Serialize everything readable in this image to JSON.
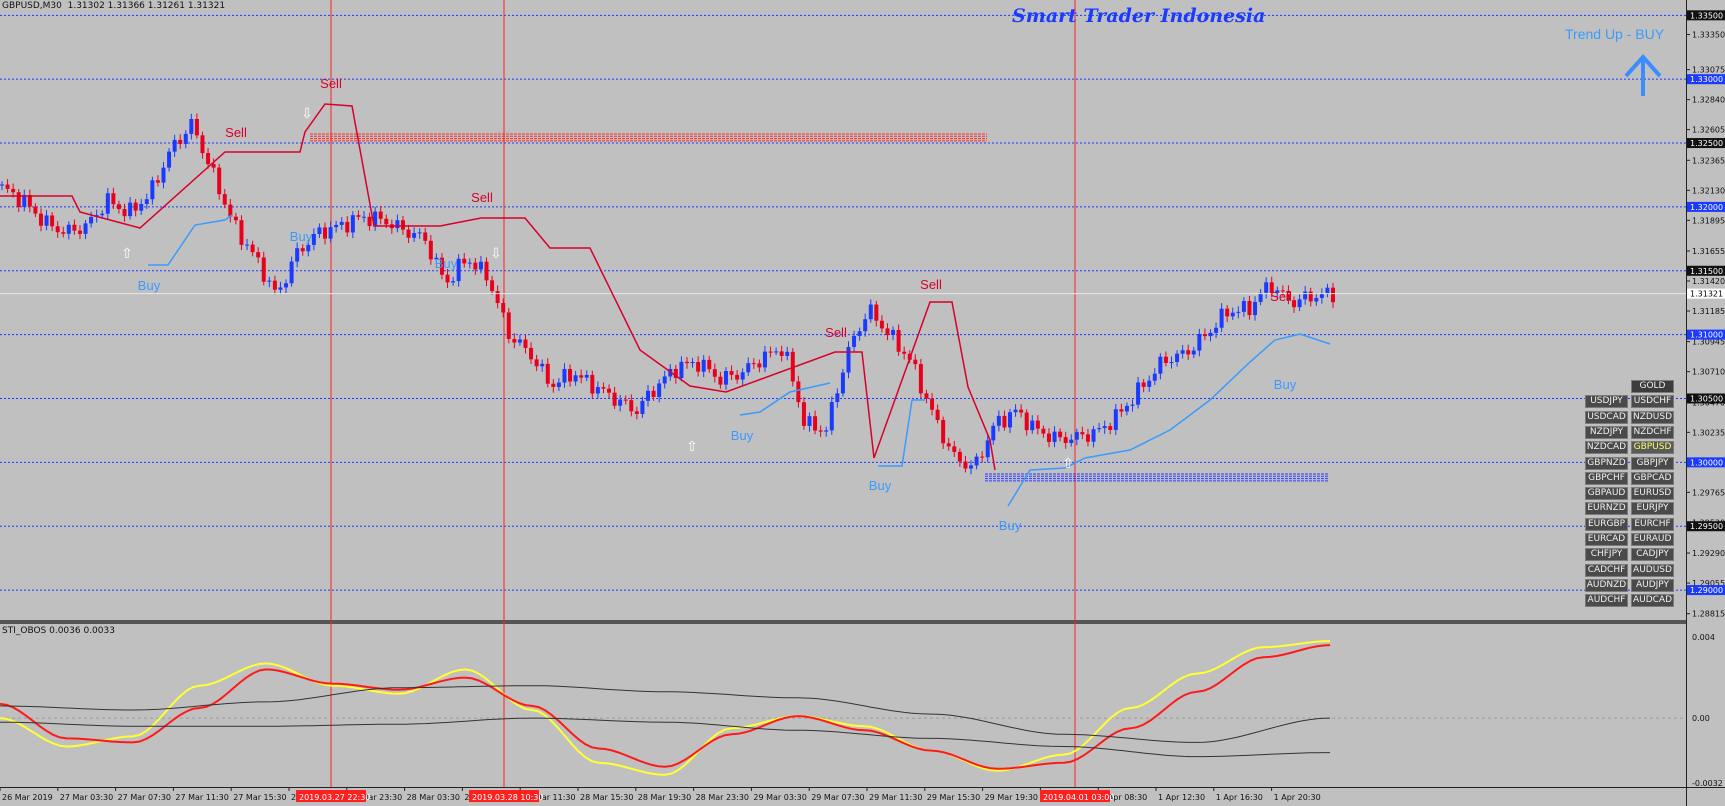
{
  "header": {
    "symbol_info": "GBPUSD,M30  1.31302 1.31366 1.31261 1.31321",
    "brand": "Smart Trader Indonesia",
    "trend_label": "Trend Up - BUY"
  },
  "chart_data": [
    {
      "type": "candlestick",
      "title": "GBPUSD,M30",
      "ohlc_current": {
        "open": 1.31302,
        "high": 1.31366,
        "low": 1.31261,
        "close": 1.31321
      },
      "ylim": [
        1.2875,
        1.3362
      ],
      "y_ticks": [
        "1.33350",
        "1.33075",
        "1.32840",
        "1.32605",
        "1.32365",
        "1.32130",
        "1.31895",
        "1.31655",
        "1.31420",
        "1.31185",
        "1.30945",
        "1.30710",
        "1.30470",
        "1.30235",
        "1.29765",
        "1.29530",
        "1.29290",
        "1.29055",
        "1.28815"
      ],
      "y_levels": [
        "1.33500",
        "1.33000",
        "1.32500",
        "1.32000",
        "1.31500",
        "1.31000",
        "1.30500",
        "1.30000",
        "1.29500",
        "1.29000"
      ],
      "current_price_label": "1.31321",
      "current_price": 1.31321,
      "grid": false,
      "x_tick_labels": [
        "26 Mar 2019",
        "27 Mar 03:30",
        "27 Mar 07:30",
        "27 Mar 11:30",
        "27 Mar 15:30",
        "27 Mar 19:30",
        "27 Mar 23:30",
        "28 Mar 03:30",
        "28 Mar 07:30",
        "28 Mar 11:30",
        "28 Mar 15:30",
        "28 Mar 19:30",
        "28 Mar 23:30",
        "29 Mar 03:30",
        "29 Mar 07:30",
        "29 Mar 11:30",
        "29 Mar 15:30",
        "29 Mar 19:30",
        "1 Apr 04:30",
        "1 Apr 08:30",
        "1 Apr 12:30",
        "1 Apr 16:30",
        "1 Apr 20:30"
      ],
      "vline_labels": [
        "2019.03.27 22:30",
        "2019.03.28 10:30",
        "2019.04.01 03:00"
      ],
      "signals": {
        "sell_label": "Sell",
        "buy_label": "Buy"
      },
      "key_prices": [
        1.3215,
        1.3205,
        1.3188,
        1.318,
        1.3185,
        1.3205,
        1.3195,
        1.321,
        1.3245,
        1.3265,
        1.3225,
        1.3185,
        1.316,
        1.313,
        1.3165,
        1.318,
        1.3185,
        1.3192,
        1.319,
        1.3182,
        1.3175,
        1.314,
        1.316,
        1.3145,
        1.31,
        1.3085,
        1.306,
        1.307,
        1.306,
        1.305,
        1.304,
        1.306,
        1.3075,
        1.3078,
        1.3065,
        1.307,
        1.3082,
        1.309,
        1.303,
        1.3025,
        1.3085,
        1.312,
        1.31,
        1.308,
        1.304,
        1.3005,
        1.2995,
        1.303,
        1.304,
        1.3025,
        1.3018,
        1.302,
        1.3025,
        1.304,
        1.306,
        1.308,
        1.3085,
        1.31,
        1.3118,
        1.312,
        1.314,
        1.3125,
        1.313,
        1.3132
      ]
    },
    {
      "type": "line",
      "title": "STI_OBOS 0.0036 0.0033",
      "y_ticks": [
        "0.004",
        "0.00",
        "-0.0032"
      ],
      "ylim": [
        -0.0032,
        0.004
      ],
      "series": [
        {
          "color": "#ffff33",
          "x": [
            0,
            0.05,
            0.1,
            0.15,
            0.2,
            0.25,
            0.3,
            0.35,
            0.4,
            0.45,
            0.5,
            0.55,
            0.6,
            0.65,
            0.7,
            0.75,
            0.8,
            0.85,
            0.9,
            0.95,
            1.0
          ],
          "values": [
            0.0,
            -0.0014,
            -0.0009,
            0.0016,
            0.0027,
            0.0016,
            0.0012,
            0.0024,
            0.0004,
            -0.0022,
            -0.0028,
            -0.0005,
            0.0001,
            -0.0004,
            -0.0016,
            -0.0026,
            -0.0018,
            0.0005,
            0.0022,
            0.0035,
            0.0038
          ]
        },
        {
          "color": "#ff1a1a",
          "x": [
            0,
            0.05,
            0.1,
            0.15,
            0.2,
            0.25,
            0.3,
            0.35,
            0.4,
            0.45,
            0.5,
            0.55,
            0.6,
            0.65,
            0.7,
            0.75,
            0.8,
            0.85,
            0.9,
            0.95,
            1.0
          ],
          "values": [
            0.0007,
            -0.001,
            -0.0012,
            0.0005,
            0.0024,
            0.0017,
            0.0014,
            0.002,
            0.0006,
            -0.0015,
            -0.0024,
            -0.0008,
            0.0001,
            -0.0006,
            -0.0016,
            -0.0025,
            -0.0022,
            -0.0005,
            0.0013,
            0.003,
            0.0036
          ]
        },
        {
          "color": "#333333",
          "x": [
            0,
            0.1,
            0.2,
            0.3,
            0.4,
            0.5,
            0.6,
            0.7,
            0.8,
            0.9,
            1.0
          ],
          "values": [
            0.0006,
            0.0004,
            0.0008,
            0.0015,
            0.0016,
            0.0013,
            0.001,
            0.0002,
            -0.0008,
            -0.0012,
            0.0
          ]
        },
        {
          "color": "#333333",
          "x": [
            0,
            0.1,
            0.2,
            0.3,
            0.4,
            0.5,
            0.6,
            0.7,
            0.8,
            0.9,
            1.0
          ],
          "values": [
            -0.0002,
            -0.0004,
            -0.0004,
            -0.0003,
            0.0,
            -0.0002,
            -0.0006,
            -0.001,
            -0.0014,
            -0.0019,
            -0.0017
          ]
        }
      ]
    }
  ],
  "symbols": [
    [
      "",
      "GOLD"
    ],
    [
      "USDJPY",
      "USDCHF"
    ],
    [
      "USDCAD",
      "NZDUSD"
    ],
    [
      "NZDJPY",
      "NZDCHF"
    ],
    [
      "NZDCAD",
      "GBPUSD"
    ],
    [
      "GBPNZD",
      "GBPJPY"
    ],
    [
      "GBPCHF",
      "GBPCAD"
    ],
    [
      "GBPAUD",
      "EURUSD"
    ],
    [
      "EURNZD",
      "EURJPY"
    ],
    [
      "EURGBP",
      "EURCHF"
    ],
    [
      "EURCAD",
      "EURAUD"
    ],
    [
      "CHFJPY",
      "CADJPY"
    ],
    [
      "CADCHF",
      "AUDUSD"
    ],
    [
      "AUDNZD",
      "AUDJPY"
    ],
    [
      "AUDCHF",
      "AUDCAD"
    ]
  ],
  "active_symbol": "GBPUSD",
  "colors": {
    "background": "#c0c0c0",
    "bull": "#1a3aff",
    "bear": "#e8001c",
    "sell": "#d8002a",
    "buy": "#3a9aff",
    "brand": "#1a3aff",
    "vline": "#ff2020",
    "level": "#1a3aff"
  }
}
